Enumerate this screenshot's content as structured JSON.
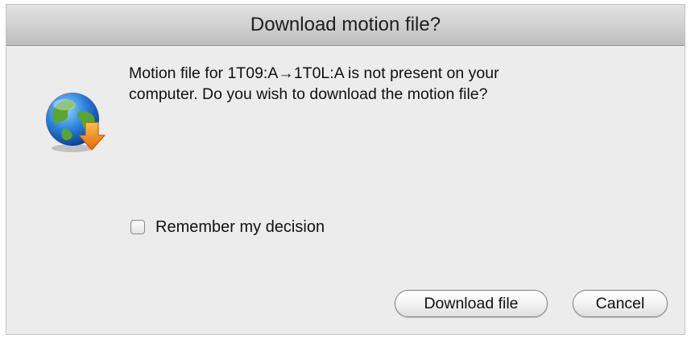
{
  "dialog": {
    "title": "Download motion file?",
    "message": "Motion file for 1T09:A→1T0L:A is not present on your computer. Do you wish to download the motion file?",
    "icon": "globe-download-icon",
    "remember_label": "Remember my decision",
    "remember_checked": false,
    "buttons": {
      "download_label": "Download file",
      "cancel_label": "Cancel"
    }
  },
  "colors": {
    "window_background": "#ececec",
    "titlebar_top": "#e2e2e2",
    "titlebar_bottom": "#bdbdbd",
    "globe_blue": "#1f6fd1",
    "globe_green": "#5aa530",
    "arrow_orange": "#f28c1e"
  }
}
